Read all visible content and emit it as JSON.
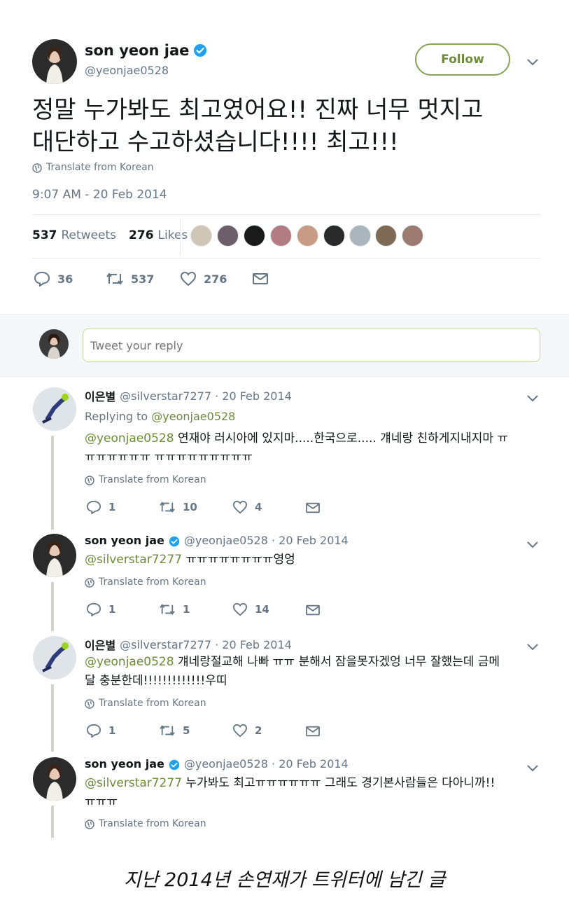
{
  "main_tweet": {
    "name": "son yeon jae",
    "handle": "@yeonjae0528",
    "follow_label": "Follow",
    "text_line1": "정말 누가봐도 최고였어요!! 진짜 너무 멋지고",
    "text_line2": "대단하고 수고하셨습니다!!!! 최고!!!",
    "translate": "Translate from Korean",
    "timestamp": "9:07 AM - 20 Feb 2014",
    "retweets_count": "537",
    "retweets_label": "Retweets",
    "likes_count": "276",
    "likes_label": "Likes",
    "actions": {
      "replies": "36",
      "retweets": "537",
      "likes": "276"
    }
  },
  "reply_box": {
    "placeholder": "Tweet your reply"
  },
  "replies": [
    {
      "name": "이은별",
      "handle_date": "@silverstar7277 · 20 Feb 2014",
      "replying_prefix": "Replying to",
      "replying_handle": "@yeonjae0528",
      "mention": "@yeonjae0528",
      "text_line1": "연재야 러시아에 있지마.....한국으로..... 걔네랑 친하게지내지마 ㅠ",
      "text_line2": "ㅠㅠㅠㅠㅠㅠ ㅠㅠㅠㅠㅠㅠㅠㅠㅠ",
      "translate": "Translate from Korean",
      "actions": {
        "replies": "1",
        "retweets": "10",
        "likes": "4"
      }
    },
    {
      "name": "son yeon jae",
      "handle_date": "@yeonjae0528 · 20 Feb 2014",
      "mention": "@silverstar7277",
      "text_line1": "ㅠㅠㅠㅠㅠㅠㅠㅠ영엉",
      "translate": "Translate from Korean",
      "actions": {
        "replies": "1",
        "retweets": "1",
        "likes": "14"
      }
    },
    {
      "name": "이은별",
      "handle_date": "@silverstar7277 · 20 Feb 2014",
      "mention": "@yeonjae0528",
      "text_line1": "걔네랑절교해 나빠 ㅠㅠ 분해서 잠을못자겠엉 너무 잘했는데 금메",
      "text_line2": "달 충분한데!!!!!!!!!!!!!우띠",
      "translate": "Translate from Korean",
      "actions": {
        "replies": "1",
        "retweets": "5",
        "likes": "2"
      }
    },
    {
      "name": "son yeon jae",
      "handle_date": "@yeonjae0528 · 20 Feb 2014",
      "mention": "@silverstar7277",
      "text_line1": "누가봐도 최고ㅠㅠㅠㅠㅠㅠ 그래도 경기본사람들은 다아니까!!",
      "text_line2": "ㅠㅠㅠ",
      "translate": "Translate from Korean"
    }
  ],
  "caption": "지난 2014년 손연재가 트위터에 남긴 글",
  "colors": {
    "accent": "#6d8b38",
    "muted": "#657786",
    "verified": "#1da1f2"
  }
}
